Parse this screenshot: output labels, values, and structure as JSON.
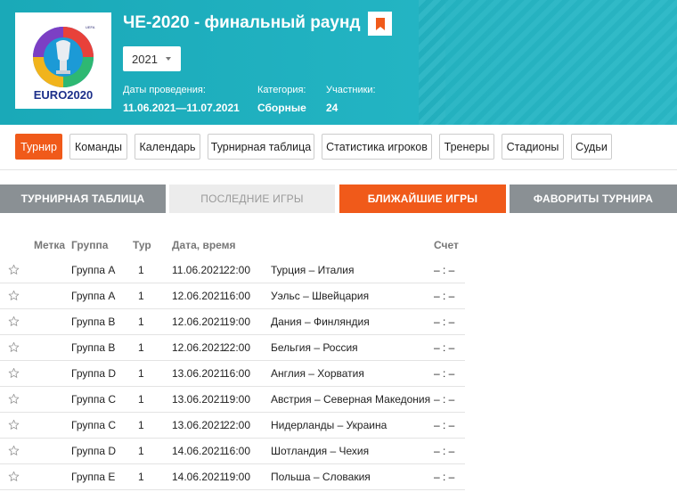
{
  "header": {
    "title": "ЧЕ-2020 - финальный раунд",
    "year_selected": "2021",
    "logo_text": "EURO2020",
    "logo_small": "UEFA",
    "meta": [
      {
        "label": "Даты проведения:",
        "value": "11.06.2021—11.07.2021"
      },
      {
        "label": "Категория:",
        "value": "Сборные"
      },
      {
        "label": "Участники:",
        "value": "24"
      }
    ]
  },
  "nav": {
    "items": [
      "Турнир",
      "Команды",
      "Календарь",
      "Турнирная таблица",
      "Статистика игроков",
      "Тренеры",
      "Стадионы",
      "Судьи"
    ],
    "active": "Турнир"
  },
  "section_tabs": [
    "Турнирная таблица",
    "Последние игры",
    "Ближайшие игры",
    "Фавориты турнира"
  ],
  "table": {
    "columns": {
      "mark": "Метка",
      "group": "Группа",
      "round": "Тур",
      "datetime": "Дата, время",
      "score": "Счет"
    },
    "rows": [
      {
        "group": "Группа A",
        "round": "1",
        "date": "11.06.2021",
        "time": "22:00",
        "match": "Турция – Италия",
        "score": "– : –"
      },
      {
        "group": "Группа A",
        "round": "1",
        "date": "12.06.2021",
        "time": "16:00",
        "match": "Уэльс – Швейцария",
        "score": "– : –"
      },
      {
        "group": "Группа B",
        "round": "1",
        "date": "12.06.2021",
        "time": "19:00",
        "match": "Дания – Финляндия",
        "score": "– : –"
      },
      {
        "group": "Группа B",
        "round": "1",
        "date": "12.06.2021",
        "time": "22:00",
        "match": "Бельгия – Россия",
        "score": "– : –"
      },
      {
        "group": "Группа D",
        "round": "1",
        "date": "13.06.2021",
        "time": "16:00",
        "match": "Англия – Хорватия",
        "score": "– : –"
      },
      {
        "group": "Группа C",
        "round": "1",
        "date": "13.06.2021",
        "time": "19:00",
        "match": "Австрия – Северная Македония",
        "score": "– : –"
      },
      {
        "group": "Группа C",
        "round": "1",
        "date": "13.06.2021",
        "time": "22:00",
        "match": "Нидерланды – Украина",
        "score": "– : –"
      },
      {
        "group": "Группа D",
        "round": "1",
        "date": "14.06.2021",
        "time": "16:00",
        "match": "Шотландия – Чехия",
        "score": "– : –"
      },
      {
        "group": "Группа E",
        "round": "1",
        "date": "14.06.2021",
        "time": "19:00",
        "match": "Польша – Словакия",
        "score": "– : –"
      }
    ]
  },
  "colors": {
    "accent": "#f05a1a",
    "banner": "#22b3c2",
    "tab_gray": "#8a9094"
  }
}
